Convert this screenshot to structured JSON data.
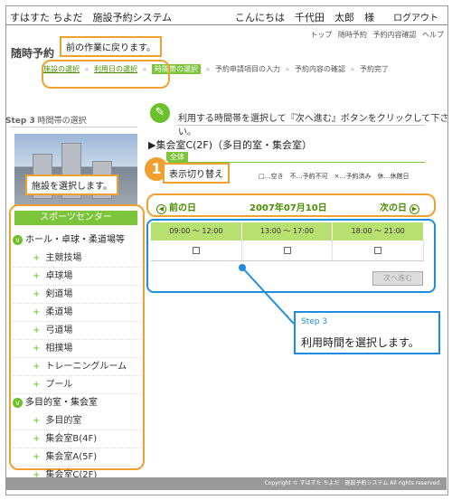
{
  "header": {
    "system_title": "すはすた ちよだ　施設予約システム",
    "greeting": "こんにちは　千代田　太郎　様",
    "logout_label": "ログアウト"
  },
  "toplinks": [
    "トップ",
    "随時予約",
    "予約内容確認",
    "ヘルプ"
  ],
  "page_section_title": "随時予約",
  "breadcrumb": {
    "steps": [
      "施設の選択",
      "利用日の選択",
      "時間帯の選択",
      "予約申請項目の入力",
      "予約内容の確認",
      "予約完了"
    ],
    "separator": "»"
  },
  "callouts": {
    "back": "前の作業に戻ります。",
    "select_facility": "施設を選択します。",
    "toggle_display": "表示切り替え",
    "step3_label": "Step 3",
    "step3_text": "利用時間を選択します。"
  },
  "step": {
    "label": "Step 3",
    "title": "時間帯の選択"
  },
  "instruction": "利用する時間帯を選択して『次へ進む』ボタンをクリックして下さい。",
  "sidebar": {
    "category_button": "スポーツセンター",
    "groups": [
      {
        "label": "ホール・卓球・柔道場等",
        "items": [
          "主競技場",
          "卓球場",
          "剣道場",
          "柔道場",
          "弓道場",
          "相撲場",
          "トレーニングルーム",
          "プール"
        ]
      },
      {
        "label": "多目的室・集会室",
        "items": [
          "多目的室",
          "集会室B(4F)",
          "集会室A(5F)",
          "集会室C(2F)"
        ]
      }
    ]
  },
  "room": {
    "title": "▶集会室C(2F)（多目的室・集会室）",
    "tab_all": "全体",
    "legend": "□…空き　不…予約不可　×…予約済み　休…休館日",
    "circle_number": "1"
  },
  "datenav": {
    "prev_label": "前の日",
    "date": "2007年07月10日",
    "next_label": "次の日"
  },
  "timeslots": [
    "09:00 ～ 12:00",
    "13:00 ～ 17:00",
    "18:00 ～ 21:00"
  ],
  "next_button": "次へ進む",
  "footer": "Copyright © すはすた ちよだ　施設予約システム All rights reserved.",
  "colors": {
    "accent_green": "#7cc43a",
    "callout_orange": "#f0a030",
    "callout_blue": "#1e8de0"
  }
}
